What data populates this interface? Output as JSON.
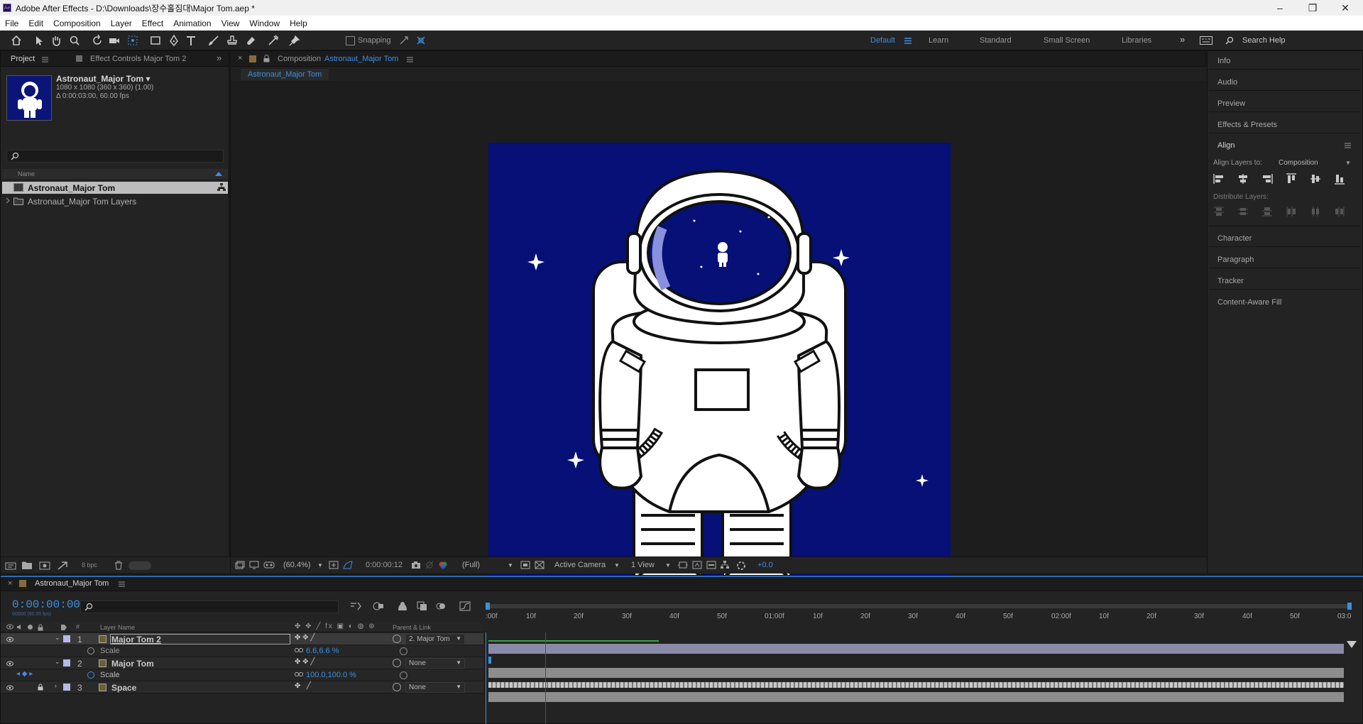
{
  "window": {
    "title": "Adobe After Effects - D:\\Downloads\\장수홀짐대\\Major Tom.aep *",
    "app_icon": "Ae",
    "minimize": "–",
    "maximize": "❐",
    "close": "✕"
  },
  "menu": [
    "File",
    "Edit",
    "Composition",
    "Layer",
    "Effect",
    "Animation",
    "View",
    "Window",
    "Help"
  ],
  "toolbar": {
    "snapping_label": "Snapping",
    "workspaces": [
      "Default",
      "Learn",
      "Standard",
      "Small Screen",
      "Libraries"
    ],
    "active_workspace": "Default",
    "more": "»",
    "search_placeholder": "Search Help"
  },
  "project_panel": {
    "tab_project": "Project",
    "tab_effect_controls": "Effect Controls Major Tom 2",
    "more": "»",
    "selected_item": {
      "name": "Astronaut_Major Tom ▾",
      "resolution": "1080 x 1080  (360 x 360) (1.00)",
      "duration": "Δ 0:00:03:00, 60.00 fps"
    },
    "column_name": "Name",
    "items": [
      {
        "name": "Astronaut_Major Tom",
        "type": "composition"
      },
      {
        "name": "Astronaut_Major Tom Layers",
        "type": "folder"
      }
    ],
    "bpc": "8 bpc"
  },
  "composition_panel": {
    "tab_label": "Composition",
    "tab_comp_name": "Astronaut_Major Tom",
    "sub_tab": "Astronaut_Major Tom",
    "footer": {
      "zoom": "(60.4%)",
      "timecode": "0:00:00:12",
      "resolution": "(Full)",
      "camera": "Active Camera",
      "views": "1 View",
      "exposure": "+0.0"
    },
    "colors": {
      "background": "#061076",
      "stars": "#ffffff"
    }
  },
  "right_panel": {
    "items": [
      "Info",
      "Audio",
      "Preview",
      "Effects & Presets"
    ],
    "align": {
      "title": "Align",
      "align_layers_to_label": "Align Layers to:",
      "align_layers_to_value": "Composition",
      "distribute_label": "Distribute Layers:"
    },
    "items_below": [
      "Character",
      "Paragraph",
      "Tracker",
      "Content-Aware Fill"
    ]
  },
  "timeline": {
    "tab_label": "Astronaut_Major Tom",
    "current_time": "0:00:00:00",
    "fps_note": "00000 (60.00 fps)",
    "col_layer_name": "Layer Name",
    "col_parent": "Parent & Link",
    "ruler_labels": [
      ":00f",
      "10f",
      "20f",
      "30f",
      "40f",
      "50f",
      "01:00f",
      "10f",
      "20f",
      "30f",
      "40f",
      "50f",
      "02:00f",
      "10f",
      "20f",
      "30f",
      "40f",
      "50f",
      "03:0"
    ],
    "layers": [
      {
        "index": "1",
        "name": "Major Tom 2",
        "parent": "2. Major Tom",
        "selected": true,
        "expanded": true,
        "property": "Scale",
        "property_value": "6.6,6.6 %"
      },
      {
        "index": "2",
        "name": "Major Tom",
        "parent": "None",
        "selected": false,
        "expanded": true,
        "property": "Scale",
        "property_value": "100.0,100.0 %"
      },
      {
        "index": "3",
        "name": "Space",
        "parent": "None",
        "selected": false,
        "expanded": false,
        "locked": true
      }
    ],
    "colors": {
      "accent": "#3d8fe0",
      "playhead": "#c02020",
      "work_area": "#37a84a"
    }
  }
}
